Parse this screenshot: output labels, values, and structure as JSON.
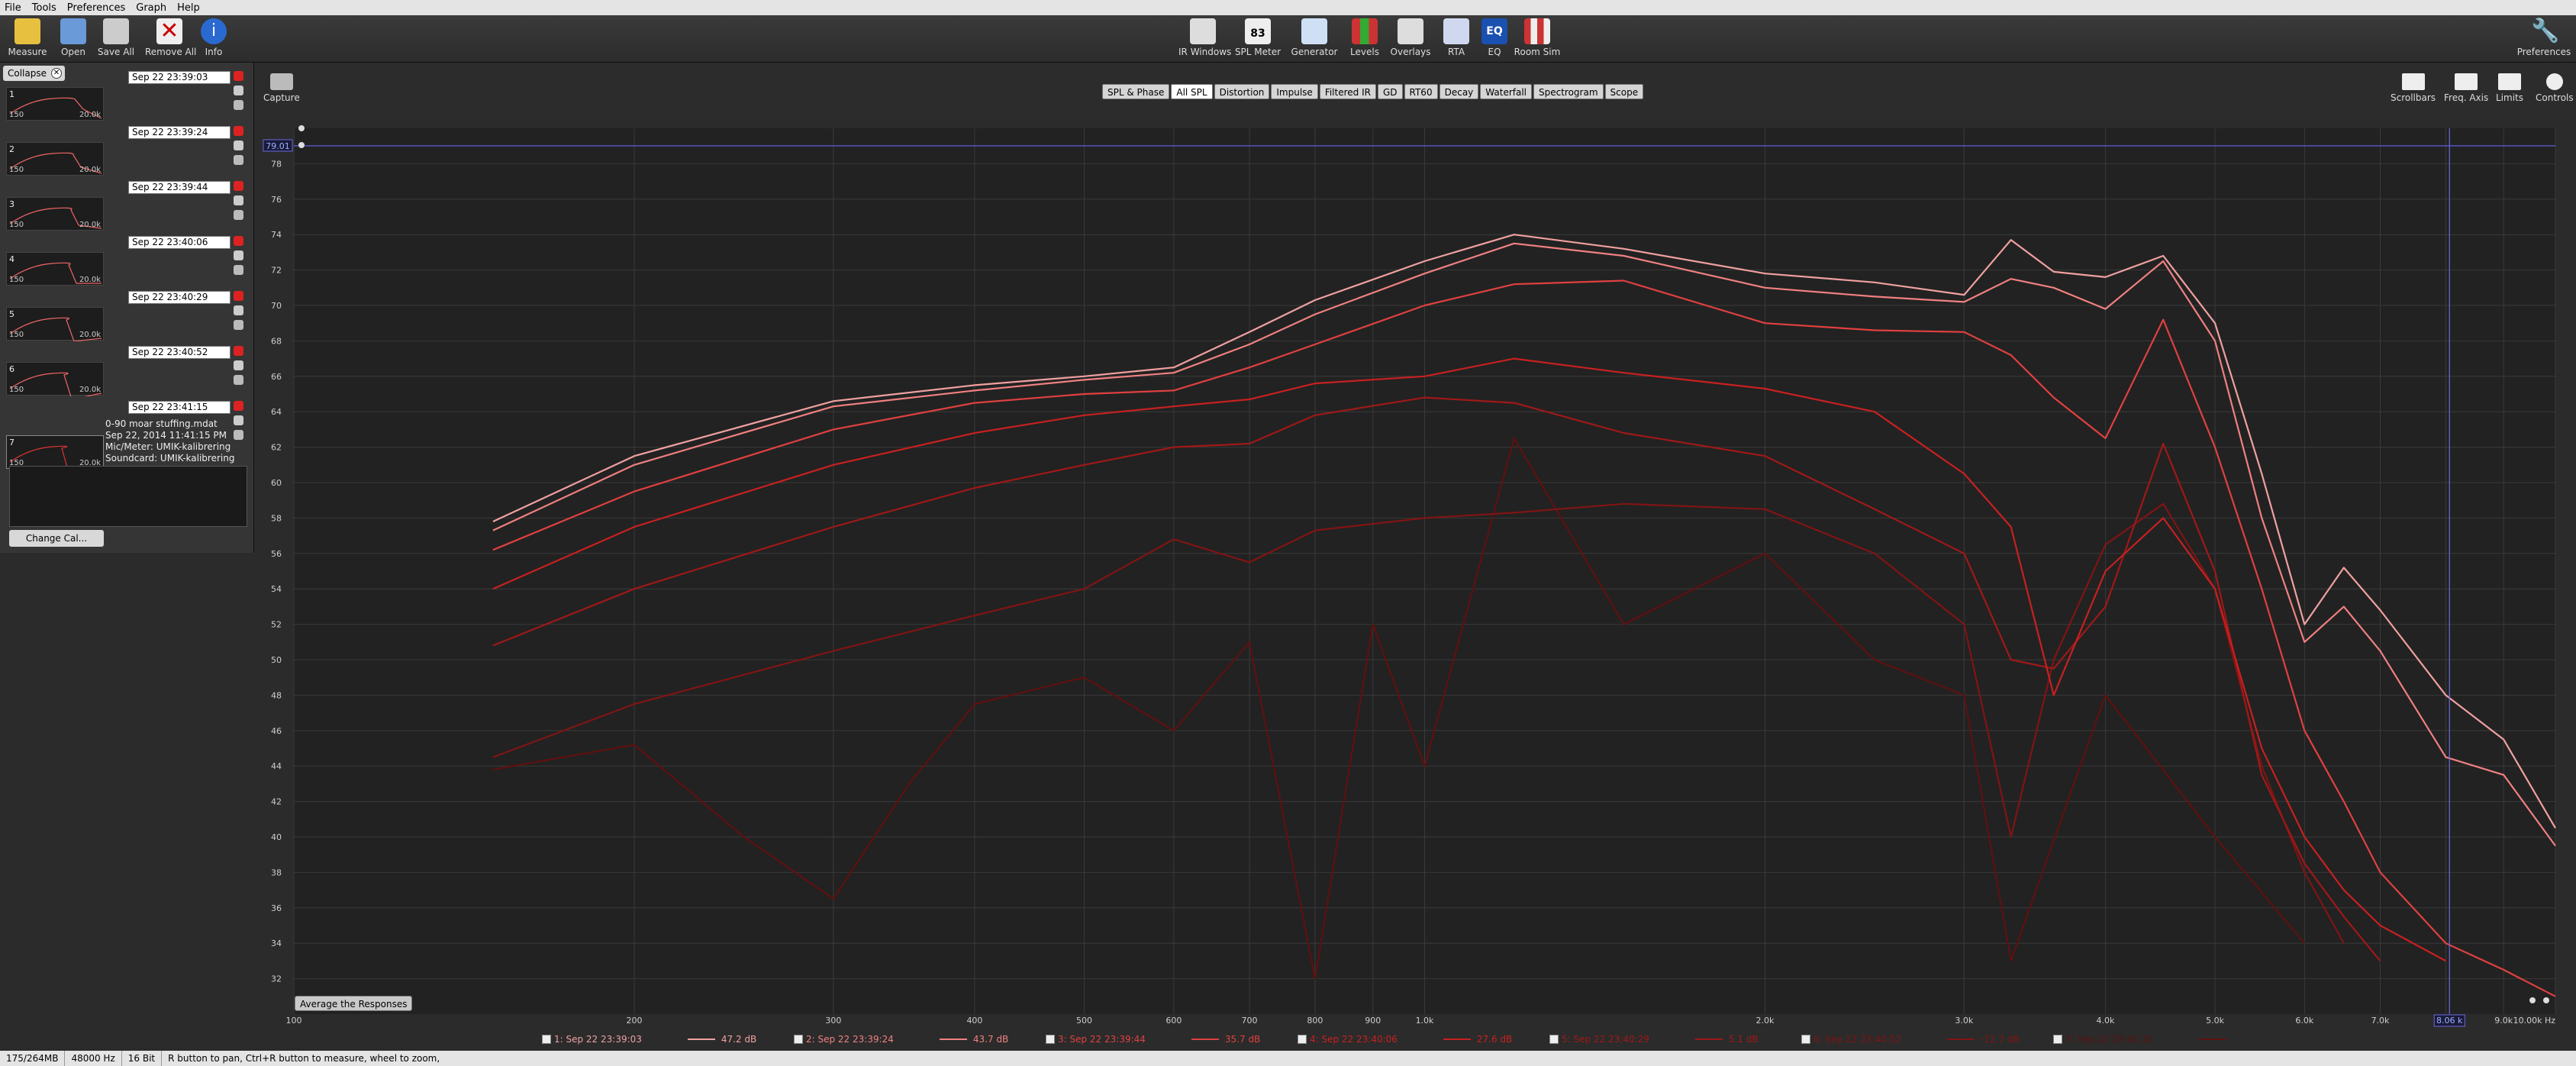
{
  "menu": [
    "File",
    "Tools",
    "Preferences",
    "Graph",
    "Help"
  ],
  "toolbar": {
    "left": [
      {
        "label": "Measure",
        "icon": "measure-icon"
      },
      {
        "label": "Open",
        "icon": "folder-icon"
      },
      {
        "label": "Save All",
        "icon": "save-icon"
      },
      {
        "label": "Remove All",
        "icon": "remove-icon"
      },
      {
        "label": "Info",
        "icon": "info-icon"
      }
    ],
    "center": [
      {
        "label": "IR Windows",
        "icon": "ir-windows-icon"
      },
      {
        "label": "SPL Meter",
        "icon": "spl-meter-icon",
        "value": "83"
      },
      {
        "label": "Generator",
        "icon": "generator-icon"
      },
      {
        "label": "Levels",
        "icon": "levels-icon"
      },
      {
        "label": "Overlays",
        "icon": "overlays-icon"
      },
      {
        "label": "RTA",
        "icon": "rta-icon"
      },
      {
        "label": "EQ",
        "icon": "eq-icon"
      },
      {
        "label": "Room Sim",
        "icon": "room-sim-icon"
      }
    ],
    "preferences": "Preferences"
  },
  "panel": {
    "collapse": "Collapse",
    "measurements": [
      {
        "num": "1",
        "name": "Sep 22 23:39:03"
      },
      {
        "num": "2",
        "name": "Sep 22 23:39:24"
      },
      {
        "num": "3",
        "name": "Sep 22 23:39:44"
      },
      {
        "num": "4",
        "name": "Sep 22 23:40:06"
      },
      {
        "num": "5",
        "name": "Sep 22 23:40:29"
      },
      {
        "num": "6",
        "name": "Sep 22 23:40:52"
      },
      {
        "num": "7",
        "name": "Sep 22 23:41:15"
      }
    ],
    "thumb_lo": "150",
    "thumb_hi": "20.0k",
    "selected": {
      "line1": "0-90 moar stuffing.mdat",
      "line2": "Sep 22, 2014 11:41:15 PM",
      "line3": "Mic/Meter: UMIK-kalibrering",
      "line4": "Soundcard: UMIK-kalibrering"
    },
    "change_cal": "Change Cal..."
  },
  "capture": "Capture",
  "tabs": [
    "SPL & Phase",
    "All SPL",
    "Distortion",
    "Impulse",
    "Filtered IR",
    "GD",
    "RT60",
    "Decay",
    "Waterfall",
    "Spectrogram",
    "Scope"
  ],
  "active_tab": "All SPL",
  "right_tools": [
    "Scrollbars",
    "Freq. Axis",
    "Limits",
    "Controls"
  ],
  "cursor_readout": "79.01",
  "freq_readout": "8.06 k",
  "average_button": "Average the Responses",
  "legend": [
    {
      "label": "1: Sep 22 23:39:03",
      "value": "47.2 dB",
      "color": "#f0a0a0"
    },
    {
      "label": "2: Sep 22 23:39:24",
      "value": "43.7 dB",
      "color": "#f08080"
    },
    {
      "label": "3: Sep 22 23:39:44",
      "value": "35.7 dB",
      "color": "#e04040"
    },
    {
      "label": "4: Sep 22 23:40:06",
      "value": "27.6 dB",
      "color": "#c82020"
    },
    {
      "label": "5: Sep 22 23:40:29",
      "value": "5.1 dB",
      "color": "#a01818"
    },
    {
      "label": "6: Sep 22 23:40:52",
      "value": "-12.7 dB",
      "color": "#801414"
    },
    {
      "label": "7: Sep 22 23:41:15",
      "value": "",
      "color": "#601010"
    }
  ],
  "status": [
    "175/264MB",
    "48000 Hz",
    "16 Bit",
    "R button to pan, Ctrl+R button to measure, wheel to zoom,"
  ],
  "chart_data": {
    "type": "line",
    "x_scale": "log",
    "xlim": [
      100,
      10000
    ],
    "ylim": [
      30,
      80
    ],
    "y_ticks": [
      32,
      34,
      36,
      38,
      40,
      42,
      44,
      46,
      48,
      50,
      52,
      54,
      56,
      58,
      60,
      62,
      64,
      66,
      68,
      70,
      72,
      74,
      76,
      78
    ],
    "x_ticks": [
      100,
      200,
      300,
      400,
      500,
      600,
      700,
      800,
      900,
      1000,
      2000,
      3000,
      4000,
      5000,
      6000,
      7000,
      8000,
      9000,
      10000
    ],
    "x_tick_labels": [
      "100",
      "200",
      "300",
      "400",
      "500",
      "600",
      "700",
      "800",
      "900",
      "1.0k",
      "2.0k",
      "3.0k",
      "4.0k",
      "5.0k",
      "6.0k",
      "7.0k",
      "8.0k",
      "9.0k",
      "10.00k Hz"
    ],
    "grid": true,
    "series": [
      {
        "x": [
          150,
          200,
          300,
          400,
          500,
          600,
          700,
          800,
          1000,
          1200,
          1500,
          2000,
          2500,
          3000,
          3300,
          3600,
          4000,
          4500,
          5000,
          5500,
          6000,
          6500,
          7000,
          8000,
          9000,
          10000
        ],
        "y": [
          57.8,
          61.5,
          64.6,
          65.5,
          66.0,
          66.5,
          68.5,
          70.3,
          72.5,
          74.0,
          73.2,
          71.8,
          71.3,
          70.6,
          73.7,
          71.9,
          71.6,
          72.8,
          69.0,
          60.5,
          52.0,
          55.2,
          52.8,
          48.0,
          45.5,
          40.5
        ]
      },
      {
        "x": [
          150,
          200,
          300,
          400,
          500,
          600,
          700,
          800,
          1000,
          1200,
          1500,
          2000,
          2500,
          3000,
          3300,
          3600,
          4000,
          4500,
          5000,
          5500,
          6000,
          6500,
          7000,
          8000,
          9000,
          10000
        ],
        "y": [
          57.3,
          61.0,
          64.3,
          65.2,
          65.8,
          66.2,
          67.8,
          69.5,
          71.8,
          73.5,
          72.8,
          71.0,
          70.5,
          70.2,
          71.5,
          71.0,
          69.8,
          72.5,
          68.0,
          58.0,
          51.0,
          53.0,
          50.5,
          44.5,
          43.5,
          39.5
        ]
      },
      {
        "x": [
          150,
          200,
          300,
          400,
          500,
          600,
          700,
          800,
          1000,
          1200,
          1500,
          2000,
          2500,
          3000,
          3300,
          3600,
          4000,
          4500,
          5000,
          5500,
          6000,
          6500,
          7000,
          8000,
          9000,
          10000
        ],
        "y": [
          56.2,
          59.5,
          63.0,
          64.5,
          65.0,
          65.2,
          66.5,
          67.8,
          70.0,
          71.2,
          71.4,
          69.0,
          68.6,
          68.5,
          67.2,
          64.8,
          62.5,
          69.2,
          62.0,
          54.0,
          46.0,
          42.0,
          38.0,
          34.0,
          32.5,
          31.0
        ]
      },
      {
        "x": [
          150,
          200,
          300,
          400,
          500,
          600,
          700,
          800,
          1000,
          1200,
          1500,
          2000,
          2500,
          3000,
          3300,
          3600,
          4000,
          4500,
          5000,
          5500,
          6000,
          6500,
          7000,
          8000
        ],
        "y": [
          54.0,
          57.5,
          61.0,
          62.8,
          63.8,
          64.3,
          64.7,
          65.6,
          66.0,
          67.0,
          66.2,
          65.3,
          64.0,
          60.5,
          57.5,
          48.0,
          55.0,
          58.0,
          54.0,
          45.0,
          40.0,
          37.0,
          35.0,
          33.0
        ]
      },
      {
        "x": [
          150,
          200,
          300,
          400,
          500,
          600,
          700,
          800,
          1000,
          1200,
          1500,
          2000,
          2500,
          3000,
          3300,
          3600,
          4000,
          4500,
          5000,
          5500,
          6000,
          6500,
          7000
        ],
        "y": [
          50.8,
          54.0,
          57.5,
          59.7,
          61.0,
          62.0,
          62.2,
          63.8,
          64.8,
          64.5,
          62.8,
          61.5,
          58.5,
          56.0,
          50.0,
          49.5,
          53.0,
          62.2,
          55.0,
          43.5,
          38.5,
          35.5,
          33.0
        ]
      },
      {
        "x": [
          150,
          200,
          300,
          400,
          500,
          600,
          700,
          800,
          1000,
          1200,
          1500,
          2000,
          2500,
          3000,
          3300,
          3600,
          4000,
          4500,
          5000,
          5500,
          6000,
          6500
        ],
        "y": [
          44.5,
          47.5,
          50.5,
          52.5,
          54.0,
          56.8,
          55.5,
          57.3,
          58.0,
          58.3,
          58.8,
          58.5,
          56.0,
          52.0,
          40.0,
          50.0,
          56.5,
          58.8,
          54.0,
          44.0,
          38.0,
          34.0
        ]
      },
      {
        "x": [
          150,
          200,
          250,
          300,
          350,
          400,
          500,
          600,
          700,
          800,
          900,
          1000,
          1200,
          1500,
          2000,
          2500,
          3000,
          3300,
          4000,
          5000,
          6000
        ],
        "y": [
          43.8,
          45.2,
          40.0,
          36.5,
          43.0,
          47.5,
          49.0,
          46.0,
          51.0,
          32.0,
          52.0,
          44.0,
          62.5,
          52.0,
          56.0,
          50.0,
          48.0,
          33.0,
          48.0,
          40.0,
          34.0
        ]
      }
    ]
  }
}
